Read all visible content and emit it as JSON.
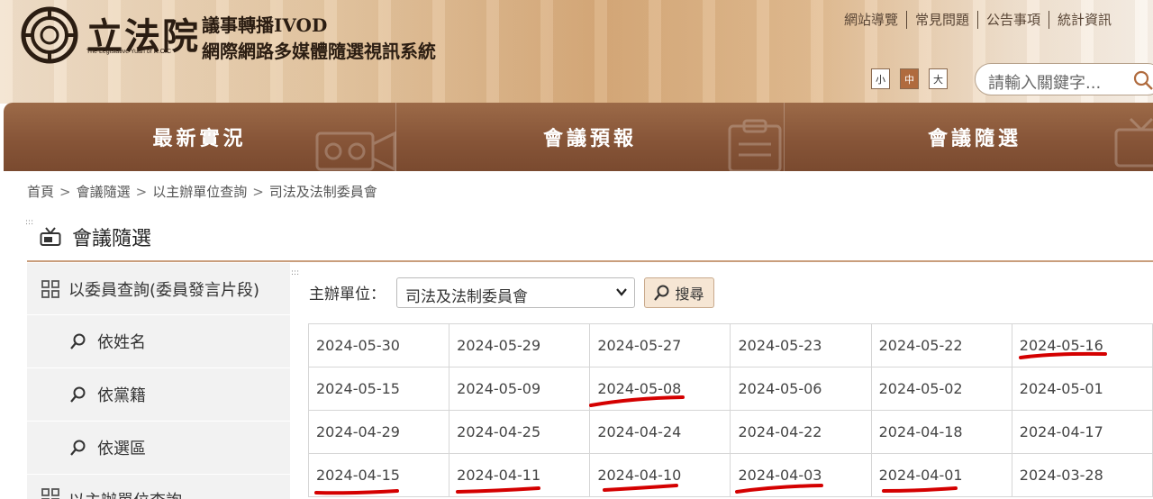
{
  "header": {
    "logo_main": "立法院",
    "logo_en": "The Legislative Yuan of R.O.C",
    "system_line1": "議事轉播IVOD",
    "system_line2": "網際網路多媒體隨選視訊系統",
    "top_links": [
      "網站導覽",
      "常見問題",
      "公告事項",
      "統計資訊"
    ],
    "font_sizes": [
      "小",
      "中",
      "大"
    ],
    "search_placeholder": "請輸入關鍵字..."
  },
  "nav": {
    "items": [
      "最新實況",
      "會議預報",
      "會議隨選"
    ]
  },
  "breadcrumb": [
    "首頁",
    "會議隨選",
    "以主辦單位查詢",
    "司法及法制委員會"
  ],
  "section_title": "會議隨選",
  "sidebar": {
    "group1": "以委員查詢(委員發言片段)",
    "subs": [
      "依姓名",
      "依黨籍",
      "依選區"
    ],
    "group2": "以主辦單位查詢"
  },
  "filter": {
    "label": "主辦單位：",
    "selected": "司法及法制委員會",
    "search_button": "搜尋"
  },
  "dates": [
    [
      "2024-05-30",
      "2024-05-29",
      "2024-05-27",
      "2024-05-23",
      "2024-05-22",
      "2024-05-16"
    ],
    [
      "2024-05-15",
      "2024-05-09",
      "2024-05-08",
      "2024-05-06",
      "2024-05-02",
      "2024-05-01"
    ],
    [
      "2024-04-29",
      "2024-04-25",
      "2024-04-24",
      "2024-04-22",
      "2024-04-18",
      "2024-04-17"
    ],
    [
      "2024-04-15",
      "2024-04-11",
      "2024-04-10",
      "2024-04-03",
      "2024-04-01",
      "2024-03-28"
    ]
  ],
  "colors": {
    "nav_brown": "#875538",
    "accent_line": "#c99e7c",
    "annotation_red": "#d40000"
  }
}
